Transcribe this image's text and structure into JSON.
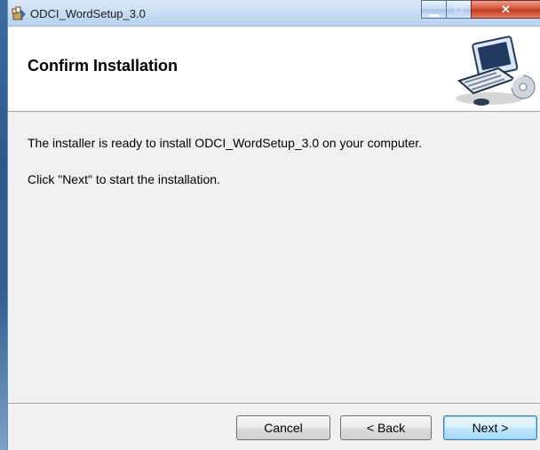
{
  "window": {
    "title": "ODCI_WordSetup_3.0",
    "controls": {
      "minimize_icon": "minimize-icon",
      "maximize_icon": "maximize-icon",
      "close_icon": "close-icon"
    }
  },
  "header": {
    "title": "Confirm Installation",
    "art_icon": "computer-setup-icon"
  },
  "content": {
    "line1": "The installer is ready to install ODCI_WordSetup_3.0 on your computer.",
    "line2": "Click \"Next\" to start the installation."
  },
  "footer": {
    "cancel_label": "Cancel",
    "back_label": "< Back",
    "next_label": "Next >"
  },
  "colors": {
    "accent": "#3c7fb1",
    "close_red": "#c13b1f",
    "window_blue": "#c7dcf4"
  }
}
